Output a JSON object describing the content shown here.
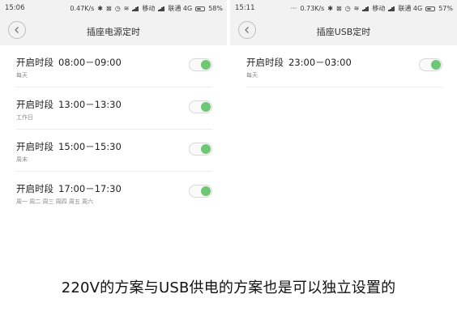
{
  "accent": "#6dc774",
  "left": {
    "status": {
      "time": "15:06",
      "speed": "0.47K/s",
      "carrier1": "移动",
      "carrier2": "联通 4G",
      "battery": "58%",
      "battery_level": 0.58
    },
    "title": "插座电源定时",
    "rows": [
      {
        "prefix": "开启时段",
        "range": "08:00－09:00",
        "repeat": "每天",
        "enabled": true
      },
      {
        "prefix": "开启时段",
        "range": "13:00－13:30",
        "repeat": "工作日",
        "enabled": true
      },
      {
        "prefix": "开启时段",
        "range": "15:00－15:30",
        "repeat": "周末",
        "enabled": true
      },
      {
        "prefix": "开启时段",
        "range": "17:00－17:30",
        "repeat": "周一 周二 周三 周四 周五 周六",
        "enabled": true
      }
    ]
  },
  "right": {
    "status": {
      "time": "15:11",
      "speed": "0.73K/s",
      "carrier1": "移动",
      "carrier2": "联通 4G",
      "battery": "57%",
      "battery_level": 0.57
    },
    "title": "插座USB定时",
    "rows": [
      {
        "prefix": "开启时段",
        "range": "23:00－03:00",
        "repeat": "每天",
        "enabled": true
      }
    ]
  },
  "caption": "220V的方案与USB供电的方案也是可以独立设置的"
}
